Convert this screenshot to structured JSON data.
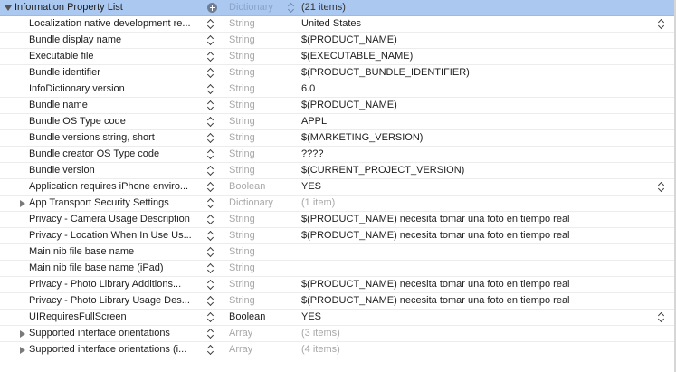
{
  "header": {
    "key": "Information Property List",
    "type": "Dictionary",
    "value": "(21 items)"
  },
  "rows": [
    {
      "key": "Localization native development re...",
      "type": "String",
      "value": "United States",
      "disclosure": "none",
      "type_active": false,
      "value_popup": true
    },
    {
      "key": "Bundle display name",
      "type": "String",
      "value": "$(PRODUCT_NAME)",
      "disclosure": "none",
      "type_active": false,
      "value_popup": false
    },
    {
      "key": "Executable file",
      "type": "String",
      "value": "$(EXECUTABLE_NAME)",
      "disclosure": "none",
      "type_active": false,
      "value_popup": false
    },
    {
      "key": "Bundle identifier",
      "type": "String",
      "value": "$(PRODUCT_BUNDLE_IDENTIFIER)",
      "disclosure": "none",
      "type_active": false,
      "value_popup": false
    },
    {
      "key": "InfoDictionary version",
      "type": "String",
      "value": "6.0",
      "disclosure": "none",
      "type_active": false,
      "value_popup": false
    },
    {
      "key": "Bundle name",
      "type": "String",
      "value": "$(PRODUCT_NAME)",
      "disclosure": "none",
      "type_active": false,
      "value_popup": false
    },
    {
      "key": "Bundle OS Type code",
      "type": "String",
      "value": "APPL",
      "disclosure": "none",
      "type_active": false,
      "value_popup": false
    },
    {
      "key": "Bundle versions string, short",
      "type": "String",
      "value": "$(MARKETING_VERSION)",
      "disclosure": "none",
      "type_active": false,
      "value_popup": false
    },
    {
      "key": "Bundle creator OS Type code",
      "type": "String",
      "value": "????",
      "disclosure": "none",
      "type_active": false,
      "value_popup": false
    },
    {
      "key": "Bundle version",
      "type": "String",
      "value": "$(CURRENT_PROJECT_VERSION)",
      "disclosure": "none",
      "type_active": false,
      "value_popup": false
    },
    {
      "key": "Application requires iPhone enviro...",
      "type": "Boolean",
      "value": "YES",
      "disclosure": "none",
      "type_active": false,
      "value_popup": true
    },
    {
      "key": "App Transport Security Settings",
      "type": "Dictionary",
      "value": "(1 item)",
      "disclosure": "closed",
      "type_active": false,
      "value_popup": false
    },
    {
      "key": "Privacy - Camera Usage Description",
      "type": "String",
      "value": "$(PRODUCT_NAME) necesita tomar una foto en tiempo real",
      "disclosure": "none",
      "type_active": false,
      "value_popup": false
    },
    {
      "key": "Privacy - Location When In Use Us...",
      "type": "String",
      "value": "$(PRODUCT_NAME) necesita tomar una foto en tiempo real",
      "disclosure": "none",
      "type_active": false,
      "value_popup": false
    },
    {
      "key": "Main nib file base name",
      "type": "String",
      "value": "",
      "disclosure": "none",
      "type_active": false,
      "value_popup": false
    },
    {
      "key": "Main nib file base name (iPad)",
      "type": "String",
      "value": "",
      "disclosure": "none",
      "type_active": false,
      "value_popup": false
    },
    {
      "key": "Privacy - Photo Library Additions...",
      "type": "String",
      "value": "$(PRODUCT_NAME) necesita tomar una foto en tiempo real",
      "disclosure": "none",
      "type_active": false,
      "value_popup": false
    },
    {
      "key": "Privacy - Photo Library Usage Des...",
      "type": "String",
      "value": "$(PRODUCT_NAME) necesita tomar una foto en tiempo real",
      "disclosure": "none",
      "type_active": false,
      "value_popup": false
    },
    {
      "key": "UIRequiresFullScreen",
      "type": "Boolean",
      "value": "YES",
      "disclosure": "none",
      "type_active": true,
      "value_popup": true
    },
    {
      "key": "Supported interface orientations",
      "type": "Array",
      "value": "(3 items)",
      "disclosure": "closed",
      "type_active": false,
      "value_popup": false
    },
    {
      "key": "Supported interface orientations (i...",
      "type": "Array",
      "value": "(4 items)",
      "disclosure": "closed",
      "type_active": false,
      "value_popup": false
    }
  ],
  "icons": {
    "disclosure_open": "triangle-down",
    "disclosure_closed": "triangle-right",
    "add": "plus-circle",
    "stepper": "up-down-chevrons"
  },
  "colors": {
    "header_bg": "#aac8f0",
    "type_gray": "#a8a8a8",
    "text": "#1d1d1d"
  }
}
